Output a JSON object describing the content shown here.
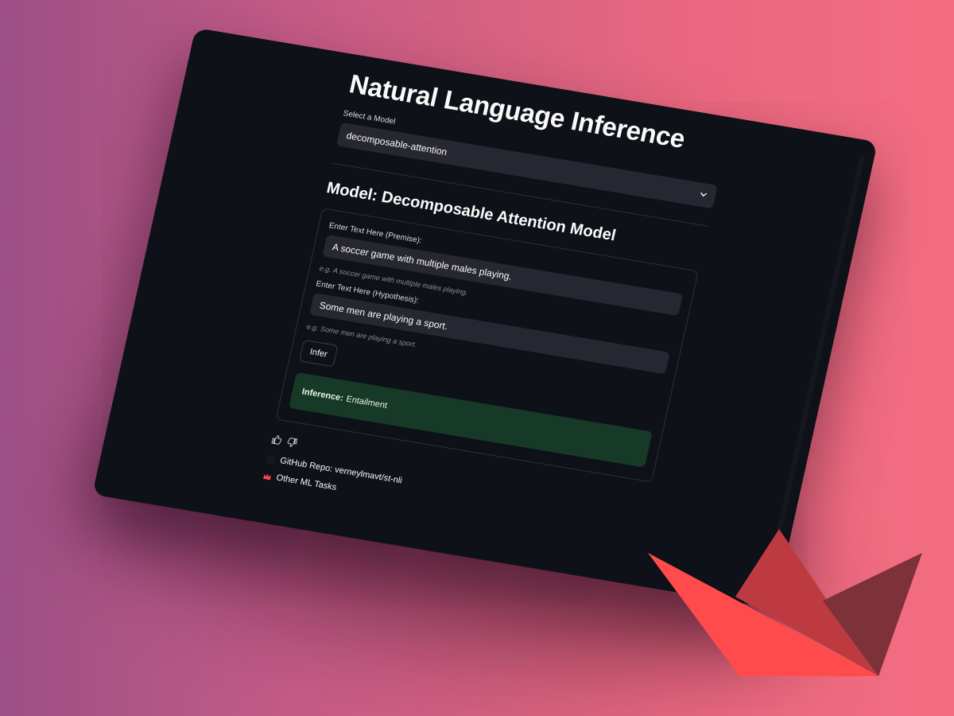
{
  "app": {
    "title": "Natural Language Inference"
  },
  "model_select": {
    "label": "Select a Model",
    "value": "decomposable-attention",
    "chevron_icon": "chevron-down-icon"
  },
  "model_header": "Model: Decomposable Attention Model",
  "premise": {
    "label": "Enter Text Here (Premise):",
    "value": "A soccer game with multiple males playing.",
    "help": "e.g. A soccer game with multiple males playing."
  },
  "hypothesis": {
    "label": "Enter Text Here (Hypothesis):",
    "value": "Some men are playing a sport.",
    "help": "e.g. Some men are playing a sport."
  },
  "infer_button": "Infer",
  "result": {
    "label": "Inference:",
    "value": "Entailment",
    "color": "#173928"
  },
  "feedback": {
    "up_icon": "thumbs-up-icon",
    "down_icon": "thumbs-down-icon"
  },
  "links": {
    "github": "GitHub Repo: verneylmavt/st-nli",
    "github_icon": "github-icon",
    "other": "Other ML Tasks",
    "other_icon": "crown-icon"
  },
  "colors": {
    "app_bg": "#0e1117",
    "input_bg": "#262730",
    "brand_red": "#ff4b4b"
  },
  "decor": {
    "logo_icon": "streamlit-boat-logo"
  }
}
